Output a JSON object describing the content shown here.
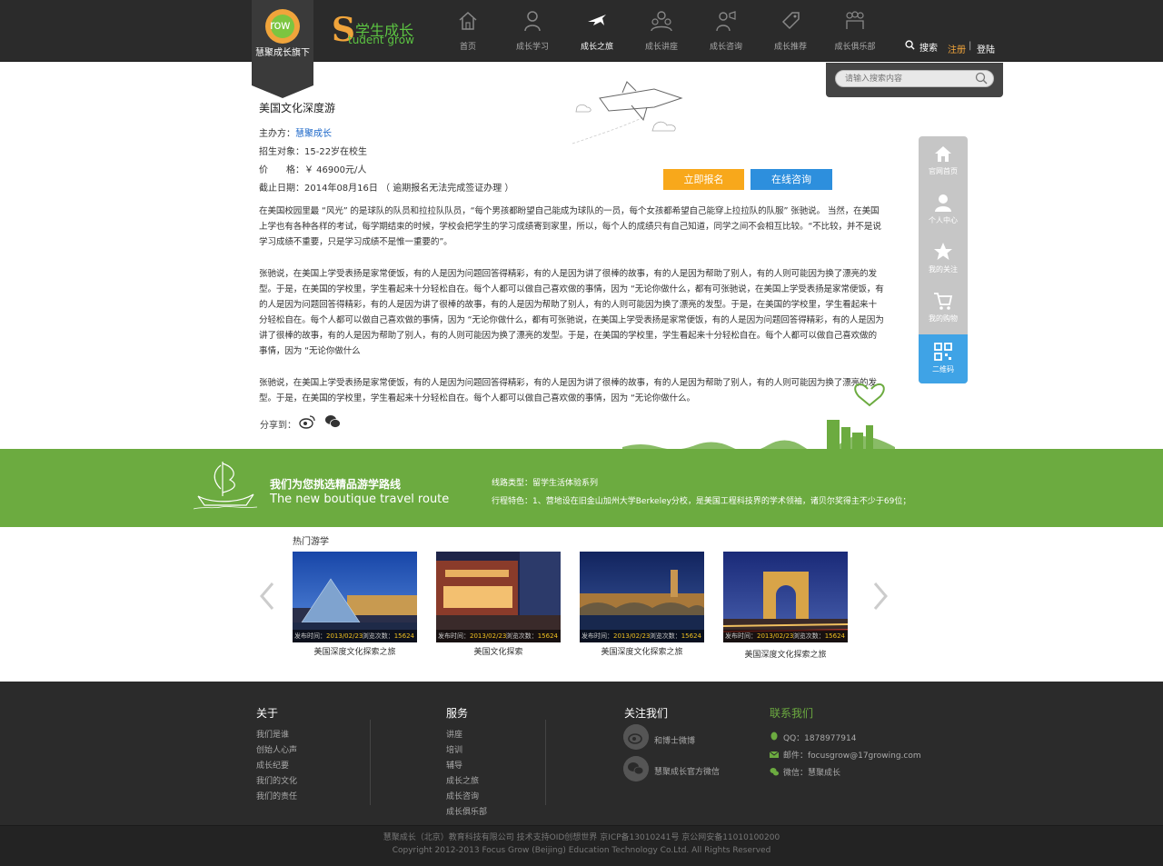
{
  "header": {
    "logo_text": "row",
    "logo_sub": "慧聚成长旗下",
    "brand_s": "S",
    "brand_cn": "学生成长",
    "brand_en": "tudent grow",
    "nav": [
      {
        "label": "首页",
        "icon": "home-icon"
      },
      {
        "label": "成长学习",
        "icon": "student-icon"
      },
      {
        "label": "成长之旅",
        "icon": "plane-icon",
        "active": true
      },
      {
        "label": "成长讲座",
        "icon": "lecture-icon"
      },
      {
        "label": "成长咨询",
        "icon": "consult-icon"
      },
      {
        "label": "成长推荐",
        "icon": "tag-icon"
      },
      {
        "label": "成长俱乐部",
        "icon": "club-icon"
      }
    ],
    "search_label": "搜索",
    "register_label": "注册",
    "separator": "|",
    "login_label": "登陆",
    "search_placeholder": "请输入搜索内容"
  },
  "detail": {
    "title": "美国文化深度游",
    "organizer_label": "主办方：",
    "organizer": "慧聚成长",
    "target": "招生对象：15-22岁在校生",
    "price": "价　　格：￥ 46900元/人",
    "deadline": "截止日期：2014年08月16日 （ 逾期报名无法完成签证办理 ）",
    "signup_button": "立即报名",
    "consult_button": "在线咨询",
    "paragraphs": [
      "在美国校园里最 “风光” 的是球队的队员和拉拉队队员，“每个男孩都盼望自己能成为球队的一员，每个女孩都希望自己能穿上拉拉队的队服” 张驰说。 当然，在美国上学也有各种各样的考试，每学期结束的时候，学校会把学生的学习成绩寄到家里，所以，每个人的成绩只有自己知道，同学之间不会相互比较。“不比较，并不是说学习成绩不重要，只是学习成绩不是惟一重要的”。",
      "张驰说，在美国上学受表扬是家常便饭，有的人是因为问题回答得精彩，有的人是因为讲了很棒的故事，有的人是因为帮助了别人，有的人则可能因为换了漂亮的发型。于是，在美国的学校里，学生看起来十分轻松自在。每个人都可以做自己喜欢做的事情，因为 “无论你做什么，都有可张驰说，在美国上学受表扬是家常便饭，有的人是因为问题回答得精彩，有的人是因为讲了很棒的故事，有的人是因为帮助了别人，有的人则可能因为换了漂亮的发型。于是，在美国的学校里，学生看起来十分轻松自在。每个人都可以做自己喜欢做的事情，因为 “无论你做什么，都有可张驰说，在美国上学受表扬是家常便饭，有的人是因为问题回答得精彩，有的人是因为讲了很棒的故事，有的人是因为帮助了别人，有的人则可能因为换了漂亮的发型。于是，在美国的学校里，学生看起来十分轻松自在。每个人都可以做自己喜欢做的事情，因为 “无论你做什么",
      "张驰说，在美国上学受表扬是家常便饭，有的人是因为问题回答得精彩，有的人是因为讲了很棒的故事，有的人是因为帮助了别人，有的人则可能因为换了漂亮的发型。于是，在美国的学校里，学生看起来十分轻松自在。每个人都可以做自己喜欢做的事情，因为 “无论你做什么。"
    ],
    "share_label": "分享到："
  },
  "sidebar": [
    {
      "label": "官网首页",
      "icon": "home-icon"
    },
    {
      "label": "个人中心",
      "icon": "user-icon"
    },
    {
      "label": "我的关注",
      "icon": "star-icon"
    },
    {
      "label": "我的购物",
      "icon": "cart-icon"
    },
    {
      "label": "二维码",
      "icon": "qr-icon",
      "active": true
    }
  ],
  "band": {
    "title_cn": "我们为您挑选精品游学路线",
    "title_en": "The new boutique travel route",
    "route_type": "线路类型：留学生活体验系列",
    "feature": "行程特色：1、营地设在旧金山加州大学Berkeley分校，是美国工程科技界的学术领袖，诸贝尔奖得主不少于69位；"
  },
  "hot": {
    "title": "热门游学",
    "cards": [
      {
        "title": "美国深度文化探索之旅",
        "date_label": "发布时间：",
        "date": "2013/02/23",
        "views_label": "浏览次数：",
        "views": "15624"
      },
      {
        "title": "美国文化探索",
        "date_label": "发布时间：",
        "date": "2013/02/23",
        "views_label": "浏览次数：",
        "views": "15624"
      },
      {
        "title": "美国深度文化探索之旅",
        "date_label": "发布时间：",
        "date": "2013/02/23",
        "views_label": "浏览次数：",
        "views": "15624"
      },
      {
        "title": "美国深度文化探索之旅",
        "date_label": "发布时间：",
        "date": "2013/02/23",
        "views_label": "浏览次数：",
        "views": "15624"
      }
    ]
  },
  "footer": {
    "about_title": "关于",
    "about_links": [
      "我们是谁",
      "创始人心声",
      "成长纪要",
      "我们的文化",
      "我们的责任"
    ],
    "service_title": "服务",
    "service_links": [
      "讲座",
      "培训",
      "辅导",
      "成长之旅",
      "成长咨询",
      "成长俱乐部"
    ],
    "follow_title": "关注我们",
    "follow_links": [
      "和博士微博",
      "慧聚成长官方微信"
    ],
    "contact_title": "联系我们",
    "contact_qq": "QQ：1878977914",
    "contact_email": "邮件：focusgrow@17growing.com",
    "contact_wechat": "微信：慧聚成长",
    "copyright_cn": "慧聚成长（北京）教育科技有限公司 技术支持OID创想世界 京ICP备13010241号 京公网安备11010100200",
    "copyright_en": "Copyright 2012-2013 Focus Grow (Beijing) Education Technology Co.Ltd. All Rights Reserved"
  },
  "colors": {
    "accent_green": "#6cab40",
    "accent_orange": "#f8a81b",
    "accent_blue": "#2d8fdd",
    "header_bg": "#2b2b2b"
  }
}
